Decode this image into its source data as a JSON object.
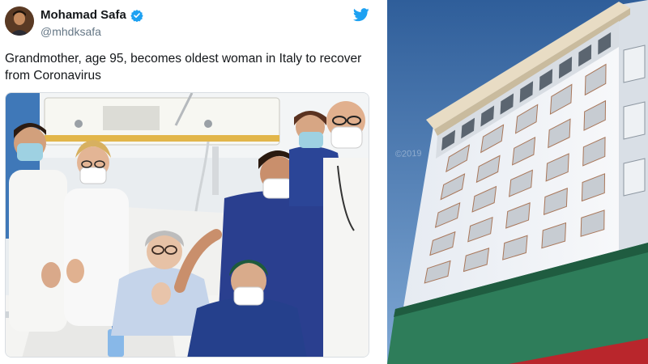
{
  "tweet": {
    "display_name": "Mohamad Safa",
    "handle": "@mhdksafa",
    "text": "Grandmother, age 95, becomes oldest woman in Italy to recover from Coronavirus",
    "verified": true,
    "icons": {
      "avatar": "avatar-photo",
      "verified": "verified-badge-icon",
      "logo": "twitter-bird-icon"
    }
  },
  "media": {
    "hospital_photo": "hospital-staff-with-patient-photo",
    "building_photo": "hospital-building-photo",
    "watermark": "©2019"
  },
  "colors": {
    "twitter_blue": "#1da1f2",
    "scrub_blue": "#2a3f8f",
    "sky_blue": "#4f7fb4",
    "building_green": "#2e7d5a"
  }
}
